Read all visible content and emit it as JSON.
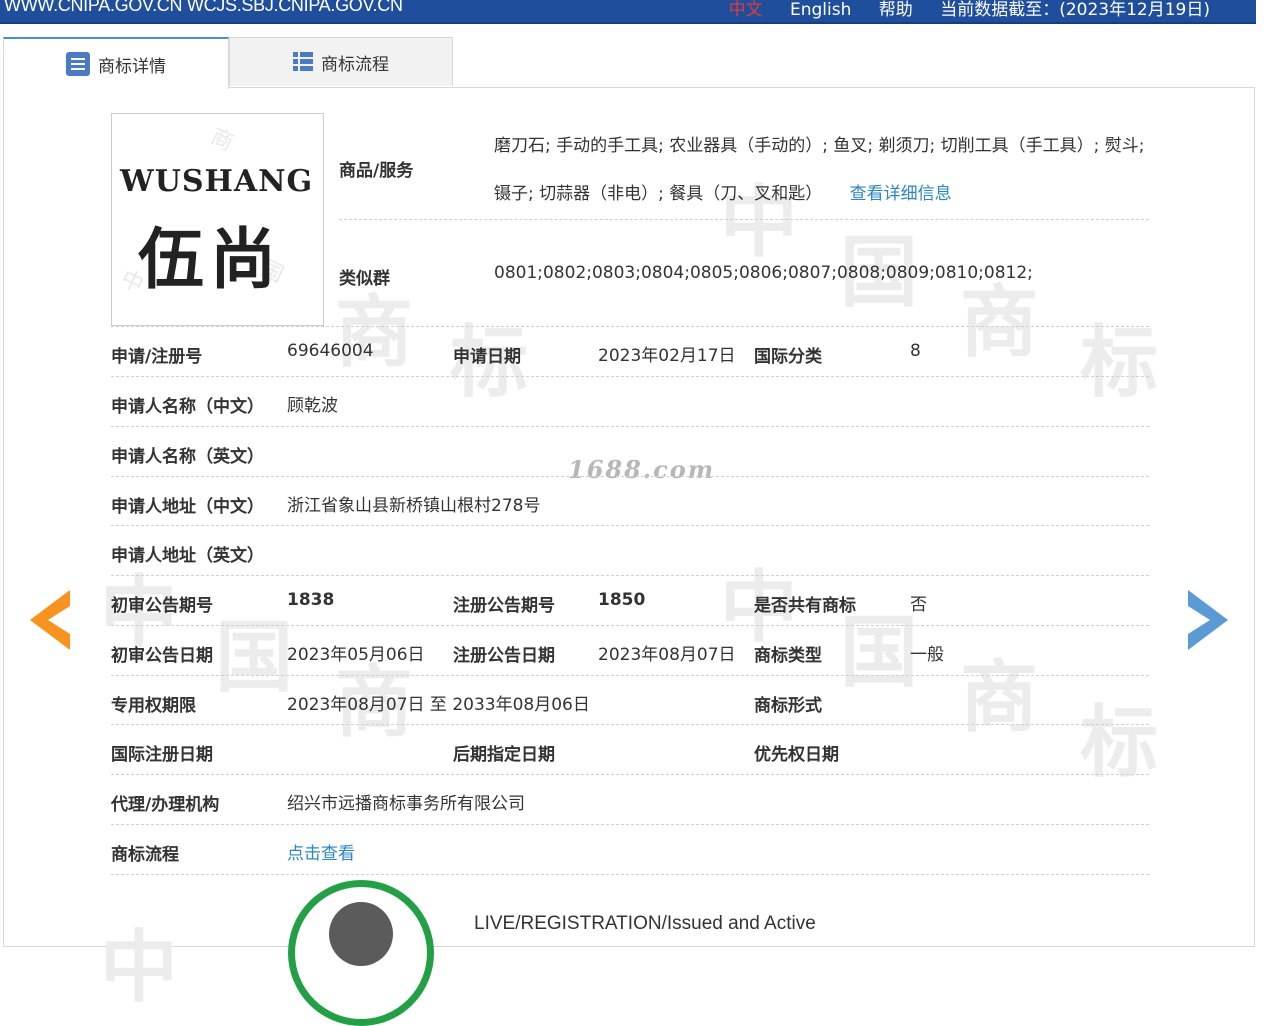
{
  "topbar": {
    "domains": "WWW.CNIPA.GOV.CN WCJS.SBJ.CNIPA.GOV.CN",
    "lang_zh": "中文",
    "lang_en": "English",
    "help": "帮助",
    "data_as_of": "当前数据截至：(2023年12月19日)"
  },
  "tabs": [
    {
      "label": "商标详情",
      "active": true
    },
    {
      "label": "商标流程",
      "active": false
    }
  ],
  "watermark": {
    "site": "1688.com",
    "chars": [
      "中",
      "国",
      "商",
      "标"
    ]
  },
  "logo": {
    "text_en": "WUSHANG",
    "text_zh": "伍尚"
  },
  "goods": {
    "label": "商品/服务",
    "value": "磨刀石; 手动的手工具; 农业器具（手动的）; 鱼叉; 剃须刀; 切削工具（手工具）; 熨斗; 镊子; 切蒜器（非电）; 餐具（刀、叉和匙）",
    "more_link": "查看详细信息"
  },
  "similar_group": {
    "label": "类似群",
    "value": "0801;0802;0803;0804;0805;0806;0807;0808;0809;0810;0812;"
  },
  "fields": {
    "reg_no": {
      "label": "申请/注册号",
      "value": "69646004"
    },
    "app_date": {
      "label": "申请日期",
      "value": "2023年02月17日"
    },
    "intl_class": {
      "label": "国际分类",
      "value": "8"
    },
    "applicant_cn": {
      "label": "申请人名称（中文）",
      "value": "顾乾波"
    },
    "applicant_en": {
      "label": "申请人名称（英文）",
      "value": ""
    },
    "address_cn": {
      "label": "申请人地址（中文）",
      "value": "浙江省象山县新桥镇山根村278号"
    },
    "address_en": {
      "label": "申请人地址（英文）",
      "value": ""
    },
    "prelim_issue": {
      "label": "初审公告期号",
      "value": "1838"
    },
    "reg_issue": {
      "label": "注册公告期号",
      "value": "1850"
    },
    "shared": {
      "label": "是否共有商标",
      "value": "否"
    },
    "prelim_date": {
      "label": "初审公告日期",
      "value": "2023年05月06日"
    },
    "reg_date": {
      "label": "注册公告日期",
      "value": "2023年08月07日"
    },
    "mark_type": {
      "label": "商标类型",
      "value": "一般"
    },
    "exclusive_period": {
      "label": "专用权期限",
      "value": "2023年08月07日 至 2033年08月06日"
    },
    "mark_form": {
      "label": "商标形式",
      "value": ""
    },
    "intl_reg_date": {
      "label": "国际注册日期",
      "value": ""
    },
    "later_designation": {
      "label": "后期指定日期",
      "value": ""
    },
    "priority_date": {
      "label": "优先权日期",
      "value": ""
    },
    "agency": {
      "label": "代理/办理机构",
      "value": "绍兴市远播商标事务所有限公司"
    },
    "flow": {
      "label": "商标流程",
      "value": "点击查看"
    }
  },
  "status": {
    "text": "LIVE/REGISTRATION/Issued and Active",
    "color": "#23a046"
  },
  "colors": {
    "topbar": "#1f4f9c",
    "link": "#2a86c7",
    "arrow_left": "#f7931e",
    "arrow_right": "#5b9bd5"
  }
}
